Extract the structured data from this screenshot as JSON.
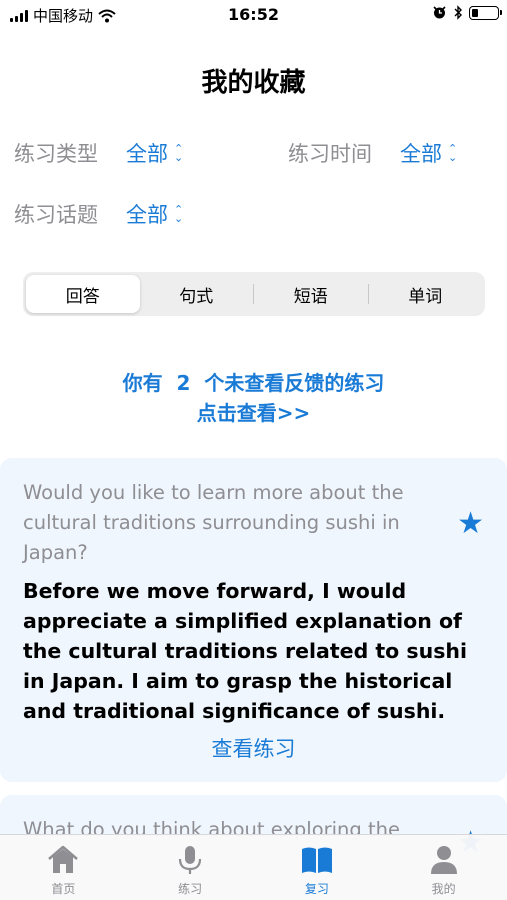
{
  "status_bar": {
    "carrier": "中国移动",
    "time": "16:52"
  },
  "title": "我的收藏",
  "filters": {
    "type_label": "练习类型",
    "type_value": "全部",
    "time_label": "练习时间",
    "time_value": "全部",
    "topic_label": "练习话题",
    "topic_value": "全部"
  },
  "segments": [
    "回答",
    "句式",
    "短语",
    "单词"
  ],
  "notice": {
    "line1": "你有  2  个未查看反馈的练习",
    "line2": "点击查看>>"
  },
  "cards": [
    {
      "question": "Would you like to learn more about the cultural traditions surrounding sushi in Japan?",
      "answer": "Before we move forward, I would appreciate a simplified explanation of the cultural traditions related to sushi in Japan. I aim to grasp the historical and traditional significance of sushi.",
      "link": "查看练习"
    },
    {
      "question": "What do you think about exploring the"
    }
  ],
  "tabs": [
    "首页",
    "练习",
    "复习",
    "我的"
  ],
  "colors": {
    "accent": "#1a7bd6",
    "card_bg": "#f0f6fd",
    "secondary_text": "#8e8e93"
  },
  "icons": [
    "signal-icon",
    "wifi-icon",
    "alarm-icon",
    "bluetooth-icon",
    "battery-icon",
    "star-icon",
    "home-icon",
    "microphone-icon",
    "book-icon",
    "person-icon"
  ]
}
